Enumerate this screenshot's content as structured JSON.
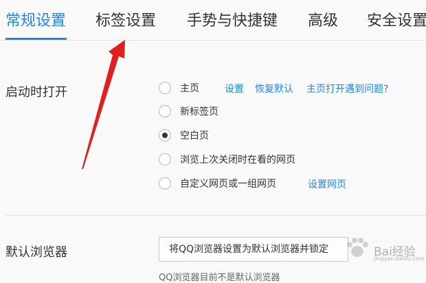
{
  "tabs": [
    {
      "label": "常规设置"
    },
    {
      "label": "标签设置"
    },
    {
      "label": "手势与快捷键"
    },
    {
      "label": "高级"
    },
    {
      "label": "安全设置"
    }
  ],
  "startup": {
    "label": "启动时打开",
    "options": [
      {
        "label": "主页",
        "checked": false
      },
      {
        "label": "新标签页",
        "checked": false
      },
      {
        "label": "空白页",
        "checked": true
      },
      {
        "label": "浏览上次关闭时在看的网页",
        "checked": false
      },
      {
        "label": "自定义网页或一组网页",
        "checked": false
      }
    ],
    "home_links": {
      "settings": "设置",
      "restore": "恢复默认",
      "problem": "主页打开遇到问题?"
    },
    "custom_link": "设置网页"
  },
  "default_browser": {
    "label": "默认浏览器",
    "button": "将QQ浏览器设置为默认浏览器并锁定",
    "note": "QQ浏览器目前不是默认浏览器"
  },
  "watermark": {
    "text": "Bai经验",
    "sub": "jingyan.baidu.com"
  },
  "colors": {
    "accent": "#1e88e5",
    "arrow": "#e02020"
  }
}
